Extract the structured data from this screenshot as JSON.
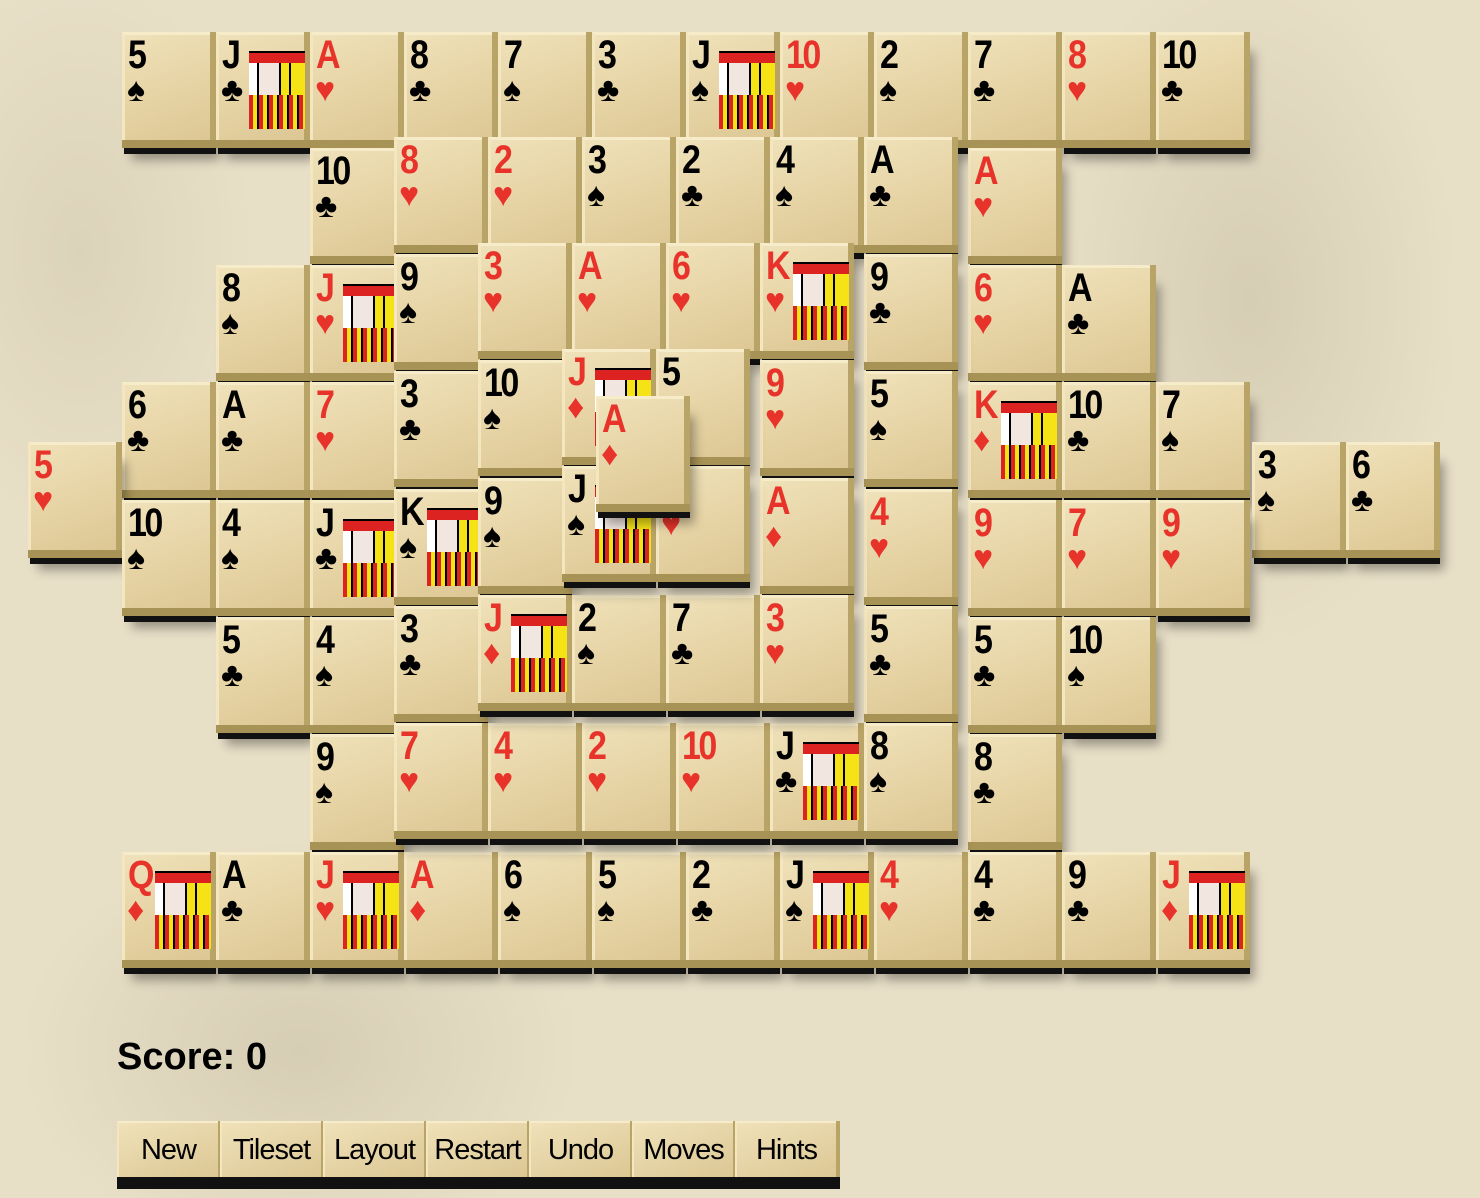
{
  "colors": {
    "red_suit": "#e8332b",
    "black_suit": "#000000",
    "tile_face": "#e6d3a4",
    "background": "#e8dfc7"
  },
  "tiles": [
    {
      "r": "5",
      "s": "♠"
    },
    {
      "r": "J",
      "s": "♣",
      "face": true
    },
    {
      "r": "A",
      "s": "♥"
    },
    {
      "r": "8",
      "s": "♣"
    },
    {
      "r": "7",
      "s": "♠"
    },
    {
      "r": "3",
      "s": "♣"
    },
    {
      "r": "J",
      "s": "♠",
      "face": true
    },
    {
      "r": "10",
      "s": "♥"
    },
    {
      "r": "2",
      "s": "♠"
    },
    {
      "r": "7",
      "s": "♣"
    },
    {
      "r": "8",
      "s": "♥"
    },
    {
      "r": "10",
      "s": "♣"
    },
    {
      "r": "10",
      "s": "♣"
    },
    {
      "r": "A",
      "s": "♥"
    },
    {
      "r": "8",
      "s": "♠"
    },
    {
      "r": "J",
      "s": "♥",
      "face": true
    },
    {
      "r": "6",
      "s": "♥"
    },
    {
      "r": "A",
      "s": "♣"
    },
    {
      "r": "6",
      "s": "♣"
    },
    {
      "r": "A",
      "s": "♣"
    },
    {
      "r": "7",
      "s": "♥"
    },
    {
      "r": "K",
      "s": "♦",
      "face": true
    },
    {
      "r": "10",
      "s": "♣"
    },
    {
      "r": "7",
      "s": "♠"
    },
    {
      "r": "5",
      "s": "♥"
    },
    {
      "r": "3",
      "s": "♠"
    },
    {
      "r": "6",
      "s": "♣"
    },
    {
      "r": "10",
      "s": "♠"
    },
    {
      "r": "4",
      "s": "♠"
    },
    {
      "r": "J",
      "s": "♣",
      "face": true
    },
    {
      "r": "9",
      "s": "♥"
    },
    {
      "r": "7",
      "s": "♥"
    },
    {
      "r": "9",
      "s": "♥"
    },
    {
      "r": "5",
      "s": "♣"
    },
    {
      "r": "4",
      "s": "♠"
    },
    {
      "r": "5",
      "s": "♣"
    },
    {
      "r": "10",
      "s": "♠"
    },
    {
      "r": "9",
      "s": "♠"
    },
    {
      "r": "8",
      "s": "♣"
    },
    {
      "r": "Q",
      "s": "♦",
      "face": true
    },
    {
      "r": "A",
      "s": "♣"
    },
    {
      "r": "J",
      "s": "♥",
      "face": true
    },
    {
      "r": "A",
      "s": "♦"
    },
    {
      "r": "6",
      "s": "♠"
    },
    {
      "r": "5",
      "s": "♠"
    },
    {
      "r": "2",
      "s": "♣"
    },
    {
      "r": "J",
      "s": "♠",
      "face": true
    },
    {
      "r": "4",
      "s": "♥"
    },
    {
      "r": "4",
      "s": "♣"
    },
    {
      "r": "9",
      "s": "♣"
    },
    {
      "r": "J",
      "s": "♦",
      "face": true
    },
    {
      "r": "8",
      "s": "♥"
    },
    {
      "r": "2",
      "s": "♥"
    },
    {
      "r": "3",
      "s": "♠"
    },
    {
      "r": "2",
      "s": "♣"
    },
    {
      "r": "4",
      "s": "♠"
    },
    {
      "r": "A",
      "s": "♣"
    },
    {
      "r": "9",
      "s": "♠"
    },
    {
      "r": "9",
      "s": "♣"
    },
    {
      "r": "3",
      "s": "♣"
    },
    {
      "r": "5",
      "s": "♠"
    },
    {
      "r": "K",
      "s": "♠",
      "face": true
    },
    {
      "r": "4",
      "s": "♥"
    },
    {
      "r": "3",
      "s": "♣"
    },
    {
      "r": "5",
      "s": "♣"
    },
    {
      "r": "7",
      "s": "♥"
    },
    {
      "r": "4",
      "s": "♥"
    },
    {
      "r": "2",
      "s": "♥"
    },
    {
      "r": "10",
      "s": "♥"
    },
    {
      "r": "J",
      "s": "♣",
      "face": true
    },
    {
      "r": "8",
      "s": "♠"
    },
    {
      "r": "3",
      "s": "♥"
    },
    {
      "r": "A",
      "s": "♥"
    },
    {
      "r": "6",
      "s": "♥"
    },
    {
      "r": "K",
      "s": "♥",
      "face": true
    },
    {
      "r": "10",
      "s": "♠"
    },
    {
      "r": "9",
      "s": "♥"
    },
    {
      "r": "9",
      "s": "♠"
    },
    {
      "r": "A",
      "s": "♦"
    },
    {
      "r": "J",
      "s": "♦",
      "face": true
    },
    {
      "r": "2",
      "s": "♠"
    },
    {
      "r": "7",
      "s": "♣"
    },
    {
      "r": "3",
      "s": "♥"
    },
    {
      "r": "J",
      "s": "♦",
      "face": true
    },
    {
      "r": "5",
      "s": "♠"
    },
    {
      "r": "J",
      "s": "♠",
      "face": true
    },
    {
      "r": "",
      "s": "♥"
    },
    {
      "r": "A",
      "s": "♦"
    }
  ],
  "score": {
    "label": "Score: 0",
    "value": 0
  },
  "buttons": [
    "New",
    "Tileset",
    "Layout",
    "Restart",
    "Undo",
    "Moves",
    "Hints"
  ]
}
